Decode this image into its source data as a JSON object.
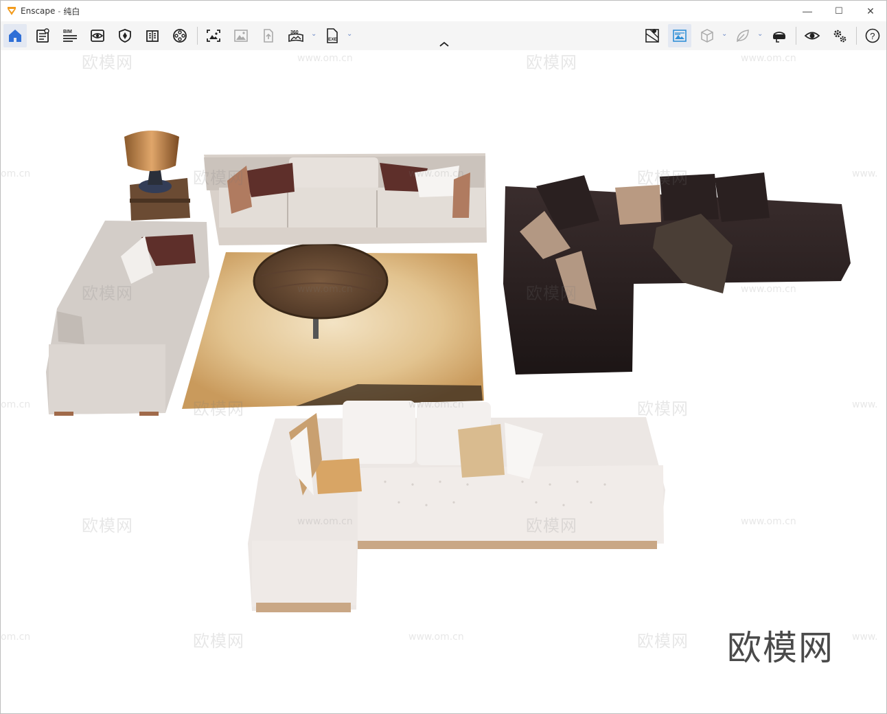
{
  "window": {
    "app_name": "Enscape",
    "separator": "-",
    "document_name": "纯白",
    "controls": {
      "minimize": "—",
      "maximize": "☐",
      "close": "✕"
    }
  },
  "toolbar": {
    "left": [
      {
        "id": "home",
        "icon": "home-icon",
        "active": true
      },
      {
        "id": "asset-library",
        "icon": "asset-library-icon"
      },
      {
        "id": "bim",
        "icon": "bim-icon",
        "label": "BIM"
      },
      {
        "id": "views",
        "icon": "views-icon"
      },
      {
        "id": "materials",
        "icon": "shield-icon"
      },
      {
        "id": "book",
        "icon": "book-icon"
      },
      {
        "id": "film",
        "icon": "film-reel-icon"
      },
      {
        "id": "screenshot",
        "icon": "screenshot-icon"
      },
      {
        "id": "batch-render",
        "icon": "image-icon"
      },
      {
        "id": "upload",
        "icon": "upload-file-icon"
      },
      {
        "id": "panorama",
        "icon": "panorama-icon",
        "label": "360"
      },
      {
        "id": "exe-export",
        "icon": "exe-export-icon",
        "label": "EXE"
      }
    ],
    "right": [
      {
        "id": "map",
        "icon": "map-pin-icon"
      },
      {
        "id": "atmosphere",
        "icon": "atmosphere-icon",
        "active": true
      },
      {
        "id": "cube",
        "icon": "cube-icon"
      },
      {
        "id": "leaf",
        "icon": "leaf-icon"
      },
      {
        "id": "vr",
        "icon": "vr-headset-icon"
      },
      {
        "id": "eye",
        "icon": "eye-icon"
      },
      {
        "id": "settings",
        "icon": "gears-icon"
      },
      {
        "id": "help",
        "icon": "help-icon",
        "label": "?"
      }
    ]
  },
  "watermarks": {
    "cn": "欧模网",
    "url": "www.om.cn",
    "url_cut": "om.cn",
    "url_cut_right": "www."
  },
  "brand_mark": "欧模网"
}
